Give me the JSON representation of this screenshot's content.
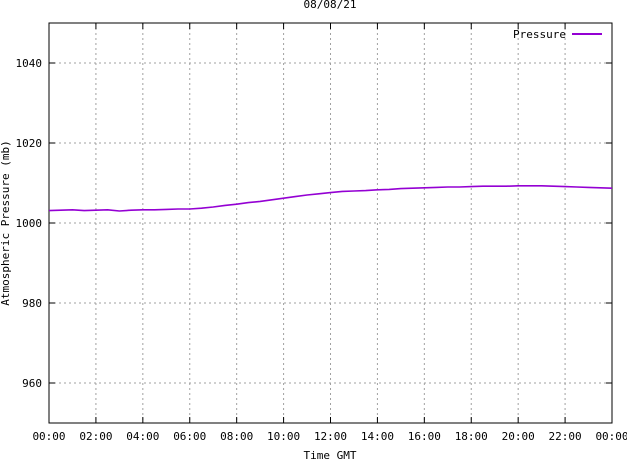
{
  "chart_data": {
    "type": "line",
    "title": "08/08/21",
    "xlabel": "Time GMT",
    "ylabel": "Atmospheric Pressure (mb)",
    "xlim": [
      0,
      24
    ],
    "ylim": [
      950,
      1050
    ],
    "x_ticks": [
      0,
      2,
      4,
      6,
      8,
      10,
      12,
      14,
      16,
      18,
      20,
      22,
      24
    ],
    "x_tick_labels": [
      "00:00",
      "02:00",
      "04:00",
      "06:00",
      "08:00",
      "10:00",
      "12:00",
      "14:00",
      "16:00",
      "18:00",
      "20:00",
      "22:00",
      "00:00"
    ],
    "y_ticks": [
      960,
      980,
      1000,
      1020,
      1040
    ],
    "y_tick_labels": [
      "960",
      "980",
      "1000",
      "1020",
      "1040"
    ],
    "grid": true,
    "legend": {
      "position": "top-right"
    },
    "series": [
      {
        "name": "Pressure",
        "color": "#9400d3",
        "x": [
          0,
          0.5,
          1,
          1.5,
          2,
          2.5,
          3,
          3.5,
          4,
          4.5,
          5,
          5.5,
          6,
          6.5,
          7,
          7.5,
          8,
          8.5,
          9,
          9.5,
          10,
          10.5,
          11,
          11.5,
          12,
          12.5,
          13,
          13.5,
          14,
          14.5,
          15,
          15.5,
          16,
          16.5,
          17,
          17.5,
          18,
          18.5,
          19,
          19.5,
          20,
          20.5,
          21,
          21.5,
          22,
          22.5,
          23,
          23.5,
          24
        ],
        "values": [
          1003.1,
          1003.2,
          1003.3,
          1003.1,
          1003.2,
          1003.3,
          1003.0,
          1003.2,
          1003.3,
          1003.3,
          1003.4,
          1003.5,
          1003.5,
          1003.7,
          1004.0,
          1004.4,
          1004.7,
          1005.1,
          1005.4,
          1005.8,
          1006.2,
          1006.6,
          1007.0,
          1007.3,
          1007.6,
          1007.9,
          1008.0,
          1008.1,
          1008.3,
          1008.4,
          1008.6,
          1008.7,
          1008.8,
          1008.9,
          1009.0,
          1009.0,
          1009.1,
          1009.2,
          1009.2,
          1009.2,
          1009.3,
          1009.3,
          1009.3,
          1009.2,
          1009.1,
          1009.0,
          1008.9,
          1008.8,
          1008.7
        ]
      }
    ]
  }
}
